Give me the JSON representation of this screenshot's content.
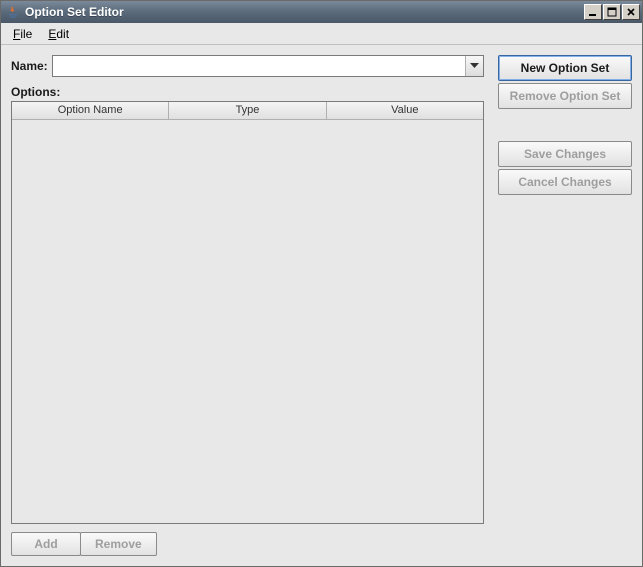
{
  "window": {
    "title": "Option Set Editor"
  },
  "menubar": {
    "file": "File",
    "edit": "Edit"
  },
  "form": {
    "name_label": "Name:",
    "name_value": "",
    "options_label": "Options:"
  },
  "table": {
    "columns": [
      "Option Name",
      "Type",
      "Value"
    ],
    "rows": []
  },
  "buttons": {
    "add": "Add",
    "remove": "Remove",
    "new_option_set": "New Option Set",
    "remove_option_set": "Remove Option Set",
    "save_changes": "Save Changes",
    "cancel_changes": "Cancel Changes"
  }
}
